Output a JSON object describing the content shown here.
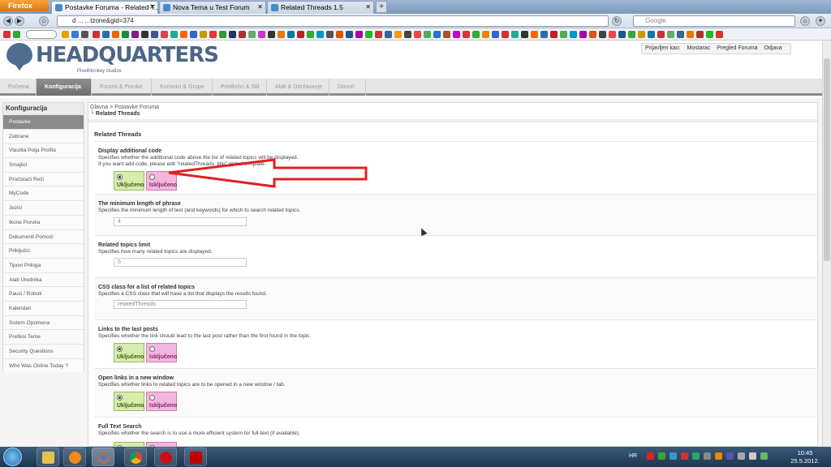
{
  "browser": {
    "app_button": "Firefox",
    "tabs": [
      {
        "label": "Postavke Foruma - Related T...",
        "active": true
      },
      {
        "label": "Nova Tema u Test Forum",
        "active": false
      },
      {
        "label": "Related Threads 1.5",
        "active": false
      }
    ],
    "url": "d ...                                           ...tzone&gid=374",
    "search_placeholder": "Google"
  },
  "site": {
    "logo_text": "HEADQUARTERS",
    "logo_sub": "PixelMonkey studios",
    "userbar": {
      "logged_in_as": "Prijavljen kao:",
      "user": "Mostarac",
      "forum_link": "Pregled Foruma",
      "logout": "Odjava"
    },
    "nav_tabs": [
      {
        "label": "Početna",
        "active": false
      },
      {
        "label": "Konfiguracija",
        "active": true
      },
      {
        "label": "Forumi & Poruke",
        "active": false
      },
      {
        "label": "Korisnici & Grupe",
        "active": false
      },
      {
        "label": "Predlošci & Stil",
        "active": false
      },
      {
        "label": "Alati & Održavanje",
        "active": false
      },
      {
        "label": "Donori",
        "active": false
      }
    ]
  },
  "sidebar": {
    "title": "Konfiguracija",
    "items": [
      {
        "label": "Postavke",
        "active": true
      },
      {
        "label": "Zabrane"
      },
      {
        "label": "Vlastita Polja Profila"
      },
      {
        "label": "Smajlići"
      },
      {
        "label": "Pročistači Reči"
      },
      {
        "label": "MyCode"
      },
      {
        "label": "Jezici"
      },
      {
        "label": "Ikone Poruka"
      },
      {
        "label": "Dokumenti Pomoći"
      },
      {
        "label": "Priključci"
      },
      {
        "label": "Tipovi Priloga"
      },
      {
        "label": "Alati Urednika"
      },
      {
        "label": "Pauci / Roboti"
      },
      {
        "label": "Kalendari"
      },
      {
        "label": "Sistem Opomena"
      },
      {
        "label": "Prefiksi Teme"
      },
      {
        "label": "Security Questions"
      },
      {
        "label": "Who Was Online Today ?"
      }
    ]
  },
  "breadcrumb": {
    "root": "Glavna",
    "parent": "Postavke Foruma",
    "current": "Related Threads"
  },
  "section_title": "Related Threads",
  "yes_label": "Uključeno",
  "no_label": "Isključeno",
  "settings": [
    {
      "title": "Display additional code",
      "desc": "Specifies whether the additional code above the list of related topics will be displayed.",
      "desc2": "If you want add code, please edit \"relatedThreads_title\" global template.",
      "type": "yesno",
      "value": "yes"
    },
    {
      "title": "The minimum length of phrase",
      "desc": "Specifies the minimum length of text (and keywords) for which to search related topics.",
      "type": "text",
      "value": "4"
    },
    {
      "title": "Related topics limit",
      "desc": "Specifies how many related topics are displayed.",
      "type": "text",
      "value": "5"
    },
    {
      "title": "CSS class for a list of related topics",
      "desc": "Specifies a CSS class that will have a list that displays the results found.",
      "type": "text",
      "value": "relatedThreads"
    },
    {
      "title": "Links to the last posts",
      "desc": "Specifies whether the link should lead to the last post rather than the first found in the topic.",
      "type": "yesno",
      "value": "yes"
    },
    {
      "title": "Open links in a new window",
      "desc": "Specifies whether links to related topics are to be opened in a new window / tab.",
      "type": "yesno",
      "value": "yes"
    },
    {
      "title": "Full Text Search",
      "desc": "Specifies whether the search is to use a more efficient system for full-text (if available).",
      "type": "yesno",
      "value": "yes"
    }
  ],
  "taskbar": {
    "language": "HR",
    "time": "10:45",
    "date": "25.5.2012."
  },
  "colors": {
    "accent_arrow": "#e02020",
    "yes_bg": "#d7ecad",
    "no_bg": "#f3b6dd",
    "active_tab": "#7f7f7f"
  }
}
